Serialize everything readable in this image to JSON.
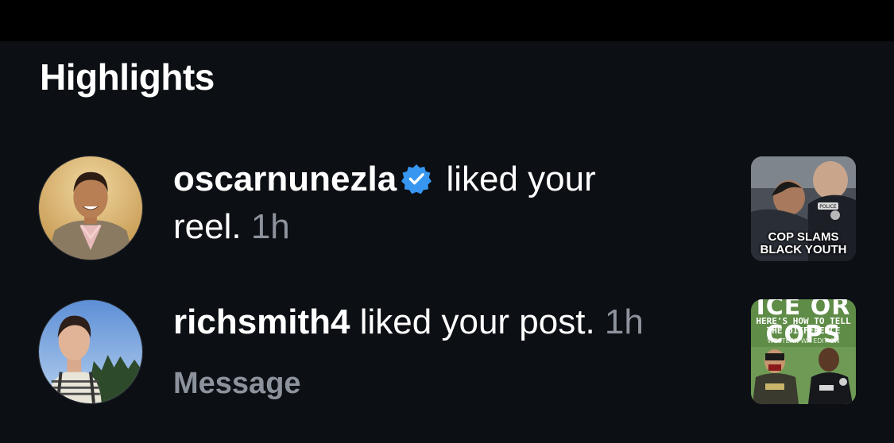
{
  "section": {
    "title": "Highlights"
  },
  "notifications": [
    {
      "username": "oscarnunezla",
      "verified": true,
      "action": "liked your",
      "object": "reel.",
      "time": "1h",
      "thumbnail": {
        "caption_line1": "COP SLAMS",
        "caption_line2": "BLACK YOUTH",
        "badge_text": "POLICE"
      }
    },
    {
      "username": "richsmith4",
      "verified": false,
      "action": "liked your post.",
      "time": "1h",
      "thumbnail": {
        "headline": "ICE OR COPS",
        "subline1": "HERE'S HOW TO TELL",
        "subline2": "THE DIFFERENCE",
        "edition": "WESTERN WA EDITION"
      },
      "secondary_action": "Message"
    }
  ],
  "colors": {
    "background": "#0c0f14",
    "muted_text": "#8d939c",
    "verified_badge": "#3797f0"
  }
}
